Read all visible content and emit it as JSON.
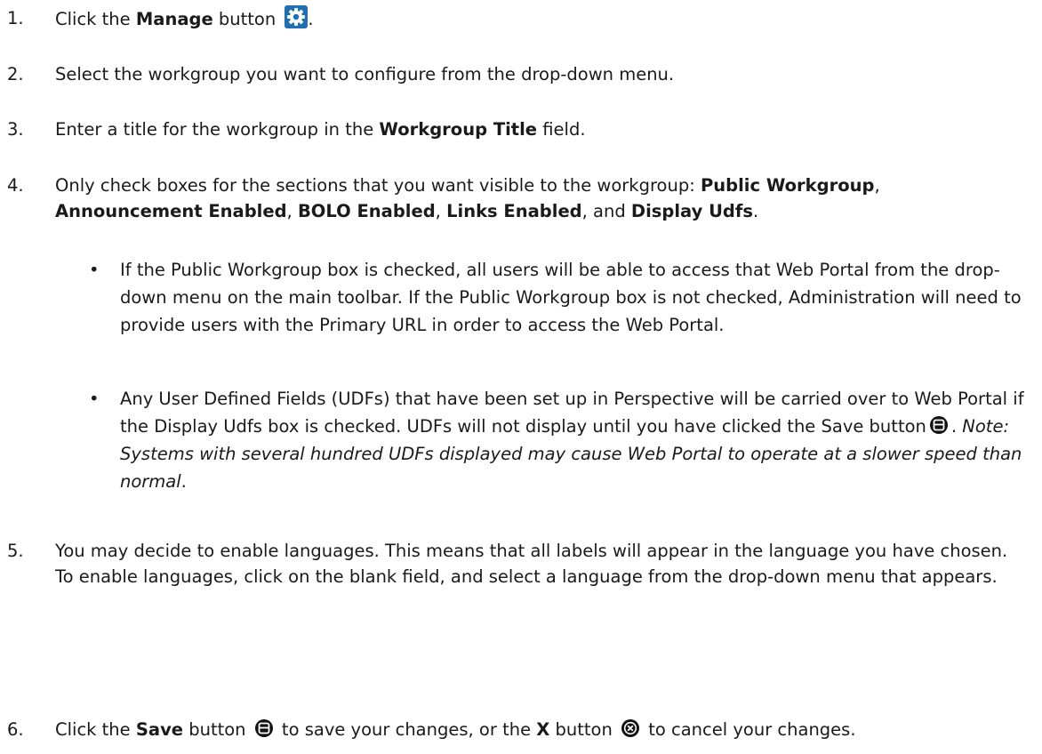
{
  "steps": [
    {
      "num": "1.",
      "pre": "Click the ",
      "bold": "Manage",
      "post": " button",
      "tail": "."
    },
    {
      "num": "2.",
      "text": "Select the workgroup you want to configure from the drop-down menu."
    },
    {
      "num": "3.",
      "pre": "Enter a title for the workgroup in the ",
      "bold": "Workgroup Title",
      "post": " field."
    },
    {
      "num": "4.",
      "pre": "Only check boxes for the sections that you want visible to the workgroup: ",
      "b1": "Public Workgroup",
      "s1": ", ",
      "b2": "Announcement Enabled",
      "s2": ", ",
      "b3": "BOLO Enabled",
      "s3": ", ",
      "b4": "Links Enabled",
      "s4": ", and ",
      "b5": "Display Udfs",
      "s5": "."
    },
    {
      "num": "5.",
      "text": "You may decide to enable languages. This means that all labels will appear in the language you have chosen. To enable languages, click on the blank field, and select a language from the drop-down menu that appears."
    },
    {
      "num": "6.",
      "pre": "Click the ",
      "bold": "Save",
      "mid": " button ",
      "mid2": " to save your changes, or the ",
      "bold2": "X",
      "mid3": " button ",
      "post": " to cancel your changes."
    }
  ],
  "bullets": [
    {
      "text": "If the Public Workgroup box is checked, all users will be able to access that Web Portal from the drop-down menu on the main toolbar. If the Public Workgroup box is not checked, Administration will need to provide users with the Primary URL in order to access the Web Portal."
    },
    {
      "pre": "Any User Defined Fields (UDFs) that have been set up in Perspective will be carried over to Web Portal if the Display Udfs box is checked. UDFs will not display until you have clicked the Save button",
      "mid": ". ",
      "italic": "Note: Systems with several hundred UDFs displayed may cause Web Portal to operate at a slower speed than normal",
      "post": "."
    }
  ],
  "bullet_glyph": "•",
  "icons": {
    "manage": "gear-icon",
    "save": "save-icon",
    "cancel": "cancel-x-icon"
  },
  "colors": {
    "manage_icon_bg": "#1f6fb5",
    "icon_dark": "#111111"
  }
}
